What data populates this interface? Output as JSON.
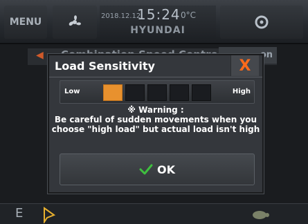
{
  "topbar": {
    "menu_label": "MENU",
    "date": "2018.12.12",
    "time": "15:24",
    "temperature": "0°C",
    "brand": "HYUNDAI"
  },
  "background": {
    "title": "Combination Speed Control",
    "right_label": "on"
  },
  "bottombar": {
    "mode_letter": "E"
  },
  "dialog": {
    "title": "Load Sensitivity",
    "close_label": "X",
    "slider": {
      "low_label": "Low",
      "high_label": "High",
      "level": 1,
      "max_level": 5
    },
    "warning_heading": "※ Warning :",
    "warning_line1": "Be careful of sudden movements when you",
    "warning_line2": "choose \"high load\" but actual load isn't high",
    "ok_label": "OK"
  },
  "colors": {
    "accent_orange": "#e8912e",
    "close_orange": "#ff6a1a",
    "ok_green": "#3fbf3f"
  }
}
